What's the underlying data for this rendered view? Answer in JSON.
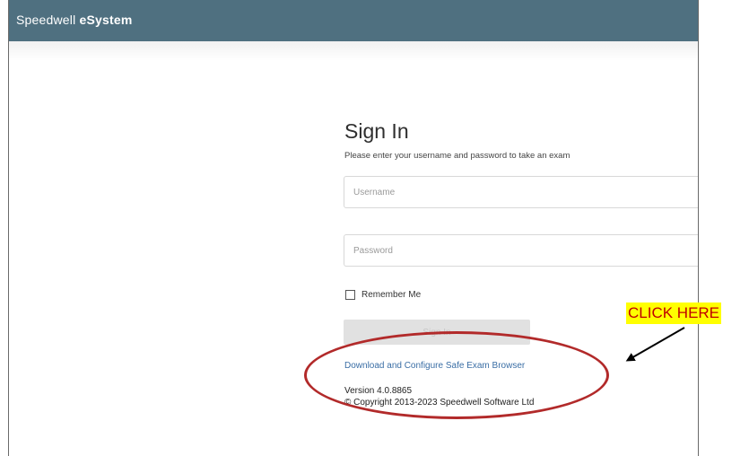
{
  "app": {
    "brand_name": "Speedwell ",
    "brand_e": "e",
    "brand_system": "System"
  },
  "signin": {
    "title": "Sign In",
    "subtitle": "Please enter your username and password to take an exam",
    "username_placeholder": "Username",
    "password_placeholder": "Password",
    "remember_label": "Remember Me",
    "button_label": "Sign In",
    "seb_link": "Download and Configure Safe Exam Browser",
    "version": "Version 4.0.8865",
    "copyright": "© Copyright 2013-2023 Speedwell Software Ltd"
  },
  "annotation": {
    "callout_text": "CLICK HERE",
    "callout_color": "#c00000",
    "highlight_color": "#ffff00",
    "ellipse_color": "#b22a2a"
  },
  "colors": {
    "topbar": "#4f7080",
    "link": "#3a6ea5"
  }
}
